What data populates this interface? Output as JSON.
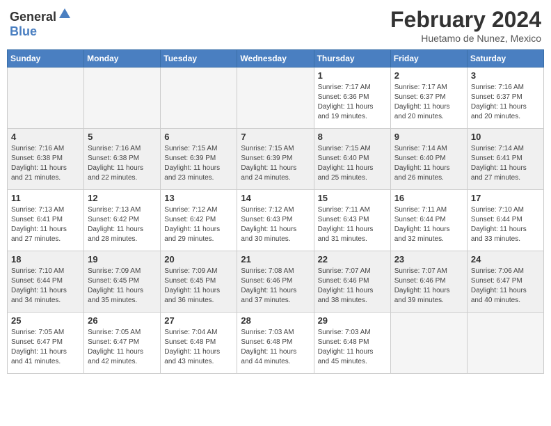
{
  "logo": {
    "text_general": "General",
    "text_blue": "Blue"
  },
  "title": "February 2024",
  "location": "Huetamo de Nunez, Mexico",
  "days_of_week": [
    "Sunday",
    "Monday",
    "Tuesday",
    "Wednesday",
    "Thursday",
    "Friday",
    "Saturday"
  ],
  "weeks": [
    [
      {
        "day": "",
        "info": ""
      },
      {
        "day": "",
        "info": ""
      },
      {
        "day": "",
        "info": ""
      },
      {
        "day": "",
        "info": ""
      },
      {
        "day": "1",
        "info": "Sunrise: 7:17 AM\nSunset: 6:36 PM\nDaylight: 11 hours\nand 19 minutes."
      },
      {
        "day": "2",
        "info": "Sunrise: 7:17 AM\nSunset: 6:37 PM\nDaylight: 11 hours\nand 20 minutes."
      },
      {
        "day": "3",
        "info": "Sunrise: 7:16 AM\nSunset: 6:37 PM\nDaylight: 11 hours\nand 20 minutes."
      }
    ],
    [
      {
        "day": "4",
        "info": "Sunrise: 7:16 AM\nSunset: 6:38 PM\nDaylight: 11 hours\nand 21 minutes."
      },
      {
        "day": "5",
        "info": "Sunrise: 7:16 AM\nSunset: 6:38 PM\nDaylight: 11 hours\nand 22 minutes."
      },
      {
        "day": "6",
        "info": "Sunrise: 7:15 AM\nSunset: 6:39 PM\nDaylight: 11 hours\nand 23 minutes."
      },
      {
        "day": "7",
        "info": "Sunrise: 7:15 AM\nSunset: 6:39 PM\nDaylight: 11 hours\nand 24 minutes."
      },
      {
        "day": "8",
        "info": "Sunrise: 7:15 AM\nSunset: 6:40 PM\nDaylight: 11 hours\nand 25 minutes."
      },
      {
        "day": "9",
        "info": "Sunrise: 7:14 AM\nSunset: 6:40 PM\nDaylight: 11 hours\nand 26 minutes."
      },
      {
        "day": "10",
        "info": "Sunrise: 7:14 AM\nSunset: 6:41 PM\nDaylight: 11 hours\nand 27 minutes."
      }
    ],
    [
      {
        "day": "11",
        "info": "Sunrise: 7:13 AM\nSunset: 6:41 PM\nDaylight: 11 hours\nand 27 minutes."
      },
      {
        "day": "12",
        "info": "Sunrise: 7:13 AM\nSunset: 6:42 PM\nDaylight: 11 hours\nand 28 minutes."
      },
      {
        "day": "13",
        "info": "Sunrise: 7:12 AM\nSunset: 6:42 PM\nDaylight: 11 hours\nand 29 minutes."
      },
      {
        "day": "14",
        "info": "Sunrise: 7:12 AM\nSunset: 6:43 PM\nDaylight: 11 hours\nand 30 minutes."
      },
      {
        "day": "15",
        "info": "Sunrise: 7:11 AM\nSunset: 6:43 PM\nDaylight: 11 hours\nand 31 minutes."
      },
      {
        "day": "16",
        "info": "Sunrise: 7:11 AM\nSunset: 6:44 PM\nDaylight: 11 hours\nand 32 minutes."
      },
      {
        "day": "17",
        "info": "Sunrise: 7:10 AM\nSunset: 6:44 PM\nDaylight: 11 hours\nand 33 minutes."
      }
    ],
    [
      {
        "day": "18",
        "info": "Sunrise: 7:10 AM\nSunset: 6:44 PM\nDaylight: 11 hours\nand 34 minutes."
      },
      {
        "day": "19",
        "info": "Sunrise: 7:09 AM\nSunset: 6:45 PM\nDaylight: 11 hours\nand 35 minutes."
      },
      {
        "day": "20",
        "info": "Sunrise: 7:09 AM\nSunset: 6:45 PM\nDaylight: 11 hours\nand 36 minutes."
      },
      {
        "day": "21",
        "info": "Sunrise: 7:08 AM\nSunset: 6:46 PM\nDaylight: 11 hours\nand 37 minutes."
      },
      {
        "day": "22",
        "info": "Sunrise: 7:07 AM\nSunset: 6:46 PM\nDaylight: 11 hours\nand 38 minutes."
      },
      {
        "day": "23",
        "info": "Sunrise: 7:07 AM\nSunset: 6:46 PM\nDaylight: 11 hours\nand 39 minutes."
      },
      {
        "day": "24",
        "info": "Sunrise: 7:06 AM\nSunset: 6:47 PM\nDaylight: 11 hours\nand 40 minutes."
      }
    ],
    [
      {
        "day": "25",
        "info": "Sunrise: 7:05 AM\nSunset: 6:47 PM\nDaylight: 11 hours\nand 41 minutes."
      },
      {
        "day": "26",
        "info": "Sunrise: 7:05 AM\nSunset: 6:47 PM\nDaylight: 11 hours\nand 42 minutes."
      },
      {
        "day": "27",
        "info": "Sunrise: 7:04 AM\nSunset: 6:48 PM\nDaylight: 11 hours\nand 43 minutes."
      },
      {
        "day": "28",
        "info": "Sunrise: 7:03 AM\nSunset: 6:48 PM\nDaylight: 11 hours\nand 44 minutes."
      },
      {
        "day": "29",
        "info": "Sunrise: 7:03 AM\nSunset: 6:48 PM\nDaylight: 11 hours\nand 45 minutes."
      },
      {
        "day": "",
        "info": ""
      },
      {
        "day": "",
        "info": ""
      }
    ]
  ]
}
